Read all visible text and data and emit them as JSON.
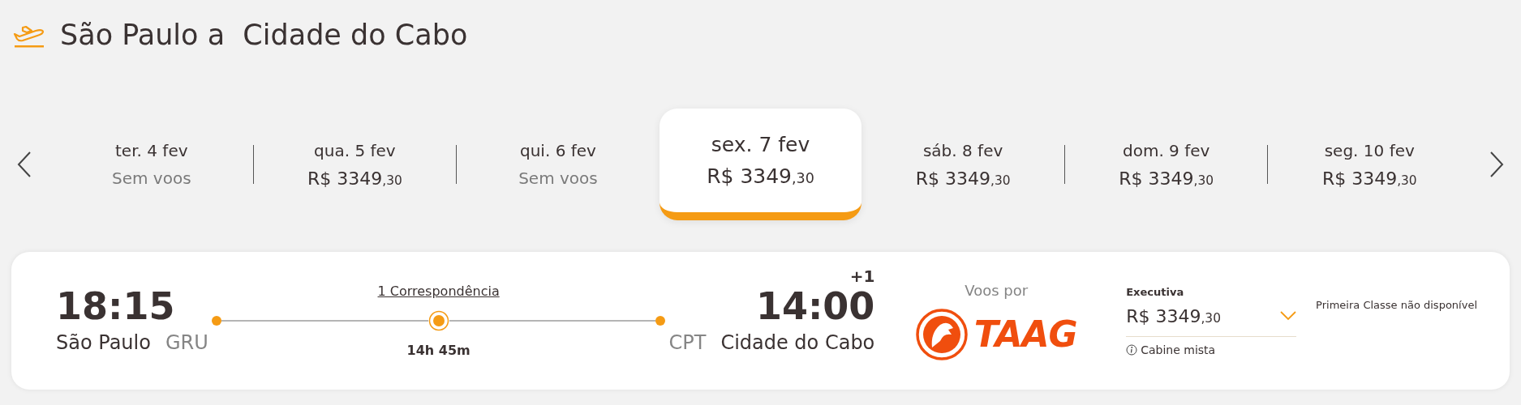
{
  "header": {
    "title": "São Paulo a  Cidade do Cabo"
  },
  "dates": [
    {
      "label": "ter. 4 fev",
      "kind": "none",
      "text": "Sem voos",
      "selected": false
    },
    {
      "label": "qua. 5 fev",
      "kind": "price",
      "main": "R$ 3349",
      "cents": ",30",
      "selected": false
    },
    {
      "label": "qui. 6 fev",
      "kind": "none",
      "text": "Sem voos",
      "selected": false
    },
    {
      "label": "sex. 7 fev",
      "kind": "price",
      "main": "R$ 3349",
      "cents": ",30",
      "selected": true
    },
    {
      "label": "sáb. 8 fev",
      "kind": "price",
      "main": "R$ 3349",
      "cents": ",30",
      "selected": false
    },
    {
      "label": "dom. 9 fev",
      "kind": "price",
      "main": "R$ 3349",
      "cents": ",30",
      "selected": false
    },
    {
      "label": "seg. 10 fev",
      "kind": "price",
      "main": "R$ 3349",
      "cents": ",30",
      "selected": false
    }
  ],
  "flight": {
    "departure": {
      "time": "18:15",
      "city": "São Paulo",
      "code": "GRU"
    },
    "stops": "1 Correspondência",
    "duration": "14h 45m",
    "arrival": {
      "time": "14:00",
      "day_offset": "+1",
      "city": "Cidade do Cabo",
      "code": "CPT"
    },
    "airline": {
      "caption": "Voos por",
      "logo_text": "TAAG"
    },
    "fare": {
      "cabin": "Executiva",
      "main": "R$ 3349",
      "cents": ",30",
      "note": "Cabine mista"
    },
    "first_class": "Primeira Classe não disponível"
  }
}
